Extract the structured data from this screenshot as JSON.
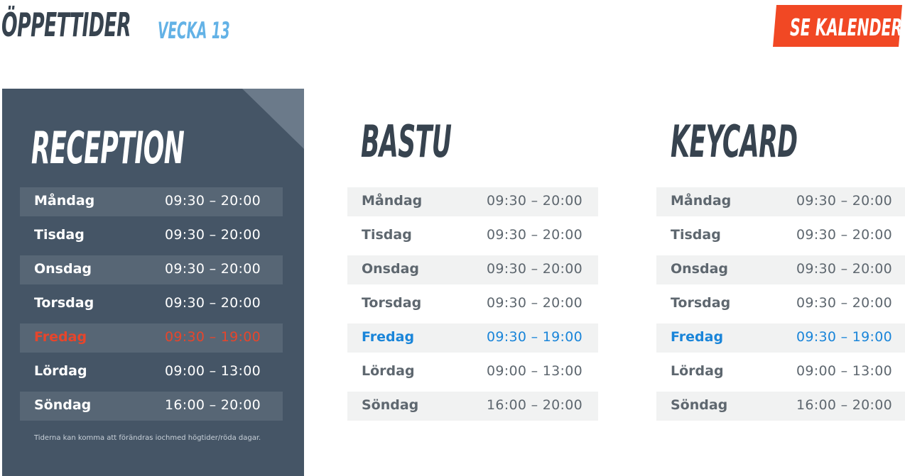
{
  "header": {
    "title": "ÖPPETTIDER",
    "week": "VECKA 13",
    "calendar_button": "SE KALENDER"
  },
  "colors": {
    "accent_orange": "#f14824",
    "accent_blue": "#63b2e6",
    "panel_dark": "#455566",
    "highlight_red": "#e7452b",
    "highlight_blue": "#1a85d9",
    "text_dark": "#37434f"
  },
  "schedules": [
    {
      "title": "RECEPTION",
      "note": "Tiderna kan komma att förändras iochmed högtider/röda dagar.",
      "rows": [
        {
          "day": "Måndag",
          "time": "09:30 – 20:00"
        },
        {
          "day": "Tisdag",
          "time": "09:30 – 20:00"
        },
        {
          "day": "Onsdag",
          "time": "09:30 – 20:00"
        },
        {
          "day": "Torsdag",
          "time": "09:30 – 20:00"
        },
        {
          "day": "Fredag",
          "time": "09:30 – 19:00"
        },
        {
          "day": "Lördag",
          "time": "09:00 – 13:00"
        },
        {
          "day": "Söndag",
          "time": "16:00 – 20:00"
        }
      ]
    },
    {
      "title": "BASTU",
      "rows": [
        {
          "day": "Måndag",
          "time": "09:30 – 20:00"
        },
        {
          "day": "Tisdag",
          "time": "09:30 – 20:00"
        },
        {
          "day": "Onsdag",
          "time": "09:30 – 20:00"
        },
        {
          "day": "Torsdag",
          "time": "09:30 – 20:00"
        },
        {
          "day": "Fredag",
          "time": "09:30 – 19:00"
        },
        {
          "day": "Lördag",
          "time": "09:00 – 13:00"
        },
        {
          "day": "Söndag",
          "time": "16:00 – 20:00"
        }
      ]
    },
    {
      "title": "KEYCARD",
      "rows": [
        {
          "day": "Måndag",
          "time": "09:30 – 20:00"
        },
        {
          "day": "Tisdag",
          "time": "09:30 – 20:00"
        },
        {
          "day": "Onsdag",
          "time": "09:30 – 20:00"
        },
        {
          "day": "Torsdag",
          "time": "09:30 – 20:00"
        },
        {
          "day": "Fredag",
          "time": "09:30 – 19:00"
        },
        {
          "day": "Lördag",
          "time": "09:00 – 13:00"
        },
        {
          "day": "Söndag",
          "time": "16:00 – 20:00"
        }
      ]
    }
  ]
}
